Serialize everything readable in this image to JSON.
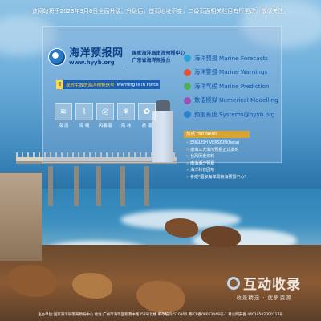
{
  "notice": "该网站将于2023年3月6日全面升级。升级后，首页地址不变，二级页面相关栏目有所更改，敬请关注。",
  "logo": {
    "name": "海洋预报网",
    "url": "www.hyyb.org",
    "org1": "国家海洋局南海预报中心",
    "org2": "广东省海洋预报台"
  },
  "warning": {
    "label_cn": "现时生效的海洋预警信号",
    "label_en": "Warning is in Force"
  },
  "quick_links": [
    {
      "label": "海 浪",
      "icon": "wave-icon",
      "glyph": "≋"
    },
    {
      "label": "海 啸",
      "icon": "tsunami-icon",
      "glyph": "⌇"
    },
    {
      "label": "风暴潮",
      "icon": "storm-surge-icon",
      "glyph": "◎"
    },
    {
      "label": "海 冰",
      "icon": "sea-ice-icon",
      "glyph": "❄"
    },
    {
      "label": "赤 潮",
      "icon": "red-tide-icon",
      "glyph": "✿"
    }
  ],
  "nav": [
    {
      "label": "海洋预报 Marine Forecasts",
      "color": "#2aa3d8"
    },
    {
      "label": "海洋警报 Marine Warnings",
      "color": "#e0523a"
    },
    {
      "label": "海洋气候 Marine Prediction",
      "color": "#4ab05a"
    },
    {
      "label": "数值模拟 Numerical Modelling",
      "color": "#9a52b8"
    },
    {
      "label": "预报系统 Systems@hyyb.org",
      "color": "#2f7fd0"
    }
  ],
  "hot_news": {
    "title": "热点 Hot News",
    "items": [
      "ENGLISH VERSION(beta)",
      "南海三大海湾预报正式发布",
      "台风历史资料",
      "南海潮汐预报",
      "海洋科普园地",
      "参观\"国家海洋局南海预报中心\""
    ]
  },
  "footer": "主办单位:国家海洋局南海预报中心  地址:广州市海珠区新港中路353号北楼 邮政编码:510300 粤ICP备08013449号-1  粤公网安备 44010502000117号",
  "watermark": {
    "main": "互动收录",
    "sub": "收录精选 · 优质资源"
  }
}
